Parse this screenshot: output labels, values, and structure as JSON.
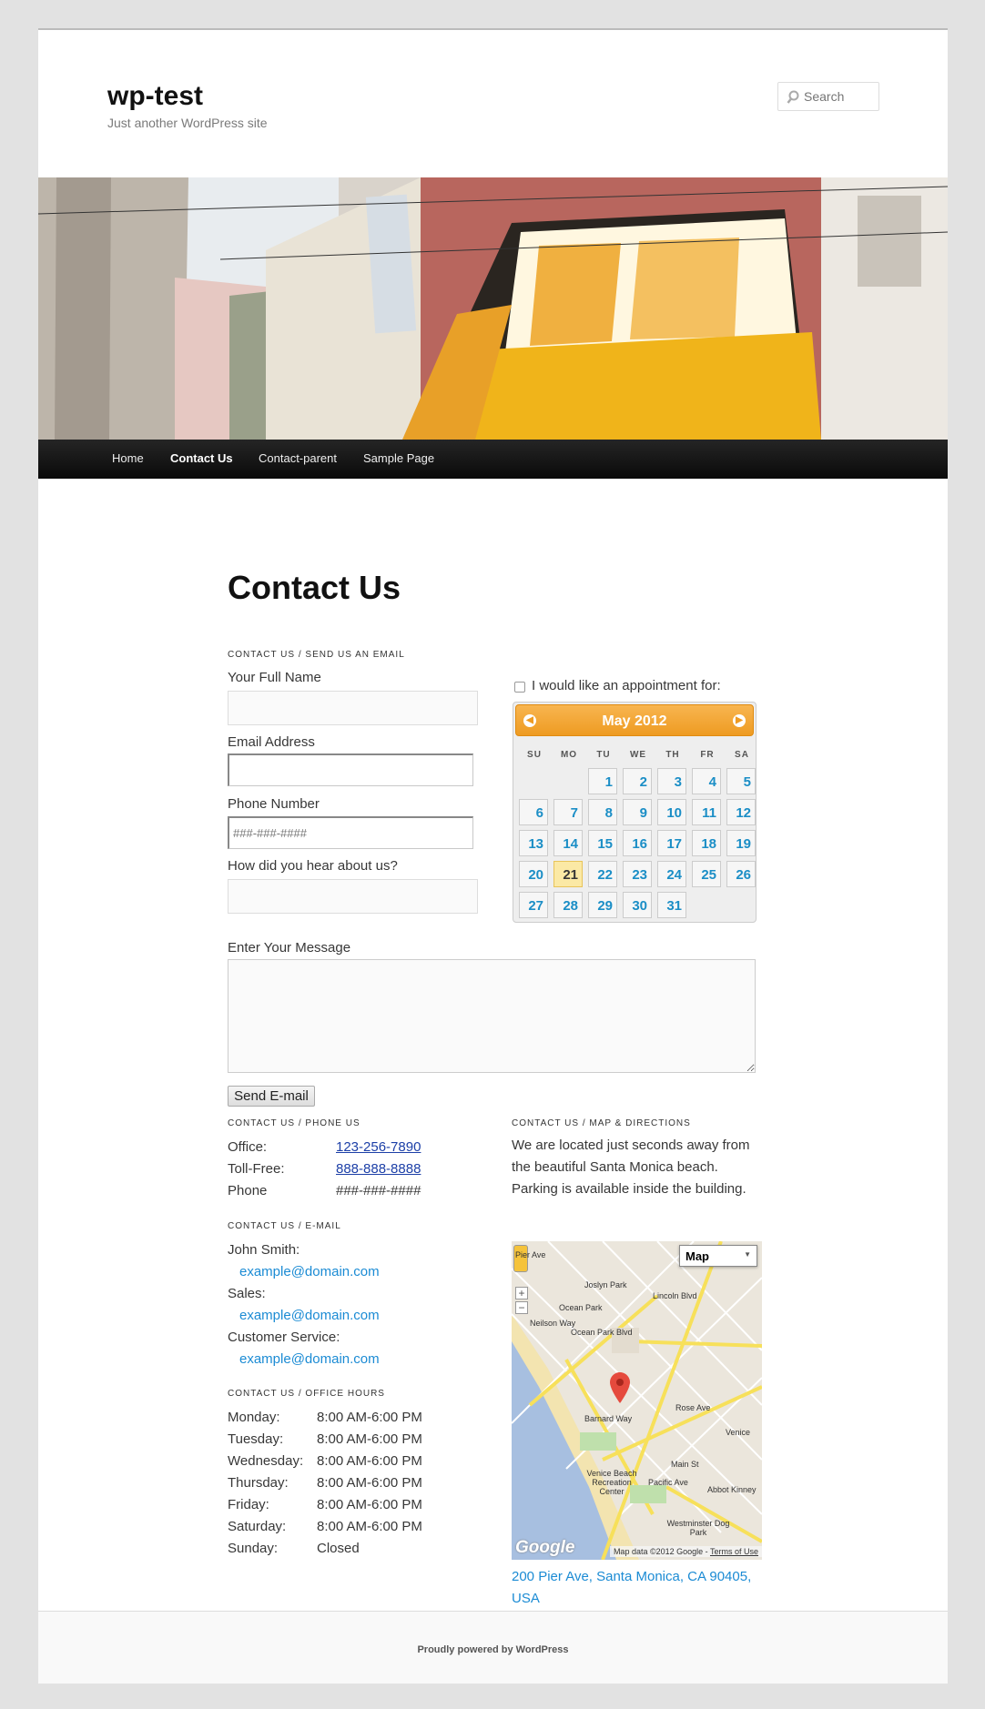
{
  "site": {
    "title": "wp-test",
    "description": "Just another WordPress site",
    "search_placeholder": "Search"
  },
  "nav": [
    "Home",
    "Contact Us",
    "Contact-parent",
    "Sample Page"
  ],
  "page_title": "Contact Us",
  "form": {
    "section": "CONTACT US / SEND US AN EMAIL",
    "name_label": "Your Full Name",
    "email_label": "Email Address",
    "phone_label": "Phone Number",
    "phone_placeholder": "###-###-####",
    "hear_label": "How did you hear about us?",
    "appointment_label": "I would like an appointment for:",
    "message_label": "Enter Your Message",
    "send_label": "Send E-mail"
  },
  "calendar": {
    "title": "May 2012",
    "weekdays": [
      "SU",
      "MO",
      "TU",
      "WE",
      "TH",
      "FR",
      "SA"
    ],
    "first_weekday": 2,
    "days_in_month": 31,
    "today": 21
  },
  "phone": {
    "section": "CONTACT US / PHONE US",
    "rows": [
      {
        "label": "Office:",
        "value": "123-256-7890",
        "link": true
      },
      {
        "label": "Toll-Free:",
        "value": "888-888-8888",
        "link": true
      },
      {
        "label": "Phone",
        "value": "###-###-####",
        "link": false
      }
    ]
  },
  "email": {
    "section": "CONTACT US / E-MAIL",
    "rows": [
      {
        "label": "John Smith:",
        "email": "example@domain.com"
      },
      {
        "label": "Sales:",
        "email": "example@domain.com"
      },
      {
        "label": "Customer Service:",
        "email": "example@domain.com"
      }
    ]
  },
  "hours": {
    "section": "CONTACT US / OFFICE HOURS",
    "rows": [
      {
        "day": "Monday:",
        "time": "8:00 AM-6:00 PM"
      },
      {
        "day": "Tuesday:",
        "time": "8:00 AM-6:00 PM"
      },
      {
        "day": "Wednesday:",
        "time": "8:00 AM-6:00 PM"
      },
      {
        "day": "Thursday:",
        "time": "8:00 AM-6:00 PM"
      },
      {
        "day": "Friday:",
        "time": "8:00 AM-6:00 PM"
      },
      {
        "day": "Saturday:",
        "time": "8:00 AM-6:00 PM"
      },
      {
        "day": "Sunday:",
        "time": "Closed"
      }
    ]
  },
  "map": {
    "section": "CONTACT US / MAP & DIRECTIONS",
    "description": "We are located just seconds away from the beautiful Santa Monica beach. Parking is available inside the building.",
    "type_label": "Map",
    "labels": [
      "Joslyn Park",
      "Ocean Park",
      "Lincoln Blvd",
      "Ocean Park Blvd",
      "Rose Ave",
      "Venice",
      "Venice Beach Recreation Center",
      "Westminster Dog Park",
      "Abbot Kinney",
      "Pacific Ave",
      "Main St",
      "Barnard Way",
      "Neilson Way",
      "Pier Ave"
    ],
    "attribution": "Map data ©2012 Google",
    "terms": "Terms of Use",
    "logo": "Google",
    "address": "200 Pier Ave, Santa Monica, CA 90405, USA"
  },
  "footer": "Proudly powered by WordPress",
  "colors": {
    "accent": "#1b8bd4",
    "calendar_header": "#f3a534",
    "nav_bg": "#1a1a1a"
  }
}
